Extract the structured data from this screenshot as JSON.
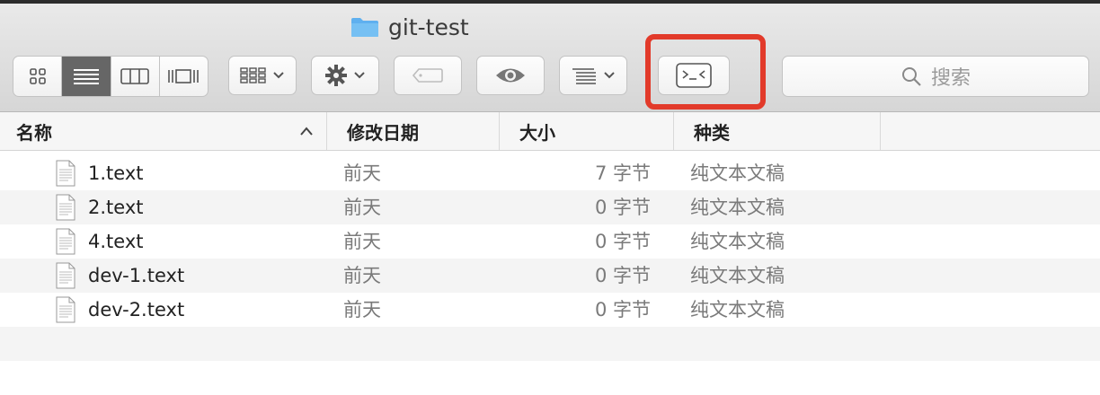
{
  "window": {
    "title": "git-test"
  },
  "toolbar": {
    "view_modes": [
      "icon-view",
      "list-view",
      "column-view",
      "cover-flow-view"
    ],
    "active_view": 1,
    "search_placeholder": "搜索"
  },
  "columns": {
    "name": "名称",
    "date": "修改日期",
    "size": "大小",
    "kind": "种类"
  },
  "files": [
    {
      "name": "1.text",
      "date": "前天",
      "size": "7 字节",
      "kind": "纯文本文稿"
    },
    {
      "name": "2.text",
      "date": "前天",
      "size": "0 字节",
      "kind": "纯文本文稿"
    },
    {
      "name": "4.text",
      "date": "前天",
      "size": "0 字节",
      "kind": "纯文本文稿"
    },
    {
      "name": "dev-1.text",
      "date": "前天",
      "size": "0 字节",
      "kind": "纯文本文稿"
    },
    {
      "name": "dev-2.text",
      "date": "前天",
      "size": "0 字节",
      "kind": "纯文本文稿"
    }
  ],
  "colors": {
    "highlight": "#e23a2a",
    "folder": "#5fb0ef"
  }
}
